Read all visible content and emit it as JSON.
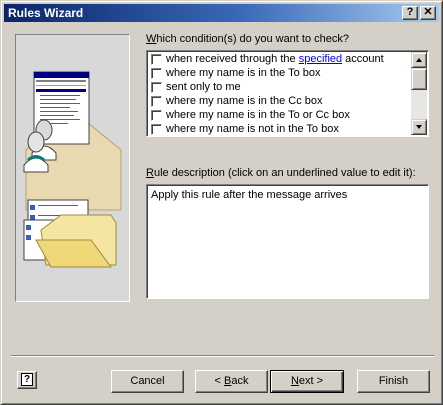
{
  "window": {
    "title": "Rules Wizard",
    "help_glyph": "?",
    "close_glyph": "✕"
  },
  "conditions": {
    "label_prefix": "",
    "label_hotkey": "W",
    "label_rest": "hich condition(s) do you want to check?",
    "items": [
      {
        "pre": "when received through the ",
        "link": "specified",
        "post": " account",
        "checked": false
      },
      {
        "pre": "where my name is in the To box",
        "link": "",
        "post": "",
        "checked": false
      },
      {
        "pre": "sent only to me",
        "link": "",
        "post": "",
        "checked": false
      },
      {
        "pre": "where my name is in the Cc box",
        "link": "",
        "post": "",
        "checked": false
      },
      {
        "pre": "where my name is in the To or Cc box",
        "link": "",
        "post": "",
        "checked": false
      },
      {
        "pre": "where my name is not in the To box",
        "link": "",
        "post": "",
        "checked": false
      }
    ]
  },
  "description": {
    "label_hotkey": "R",
    "label_rest": "ule description (click on an underlined value to edit it):",
    "text": "Apply this rule after the message arrives"
  },
  "buttons": {
    "cancel": "Cancel",
    "back_prefix": "< ",
    "back_hotkey": "B",
    "back_rest": "ack",
    "next_hotkey": "N",
    "next_rest": "ext >",
    "finish": "Finish",
    "help_glyph": "?"
  },
  "colors": {
    "titlebar_start": "#0a246a",
    "titlebar_end": "#a6caf0",
    "link": "#0000ff",
    "face": "#d4d0c8"
  },
  "icons": {
    "illustration": "rules-wizard-illustration",
    "scroll_up": "arrow-up-icon",
    "scroll_down": "arrow-down-icon",
    "help": "help-icon"
  }
}
